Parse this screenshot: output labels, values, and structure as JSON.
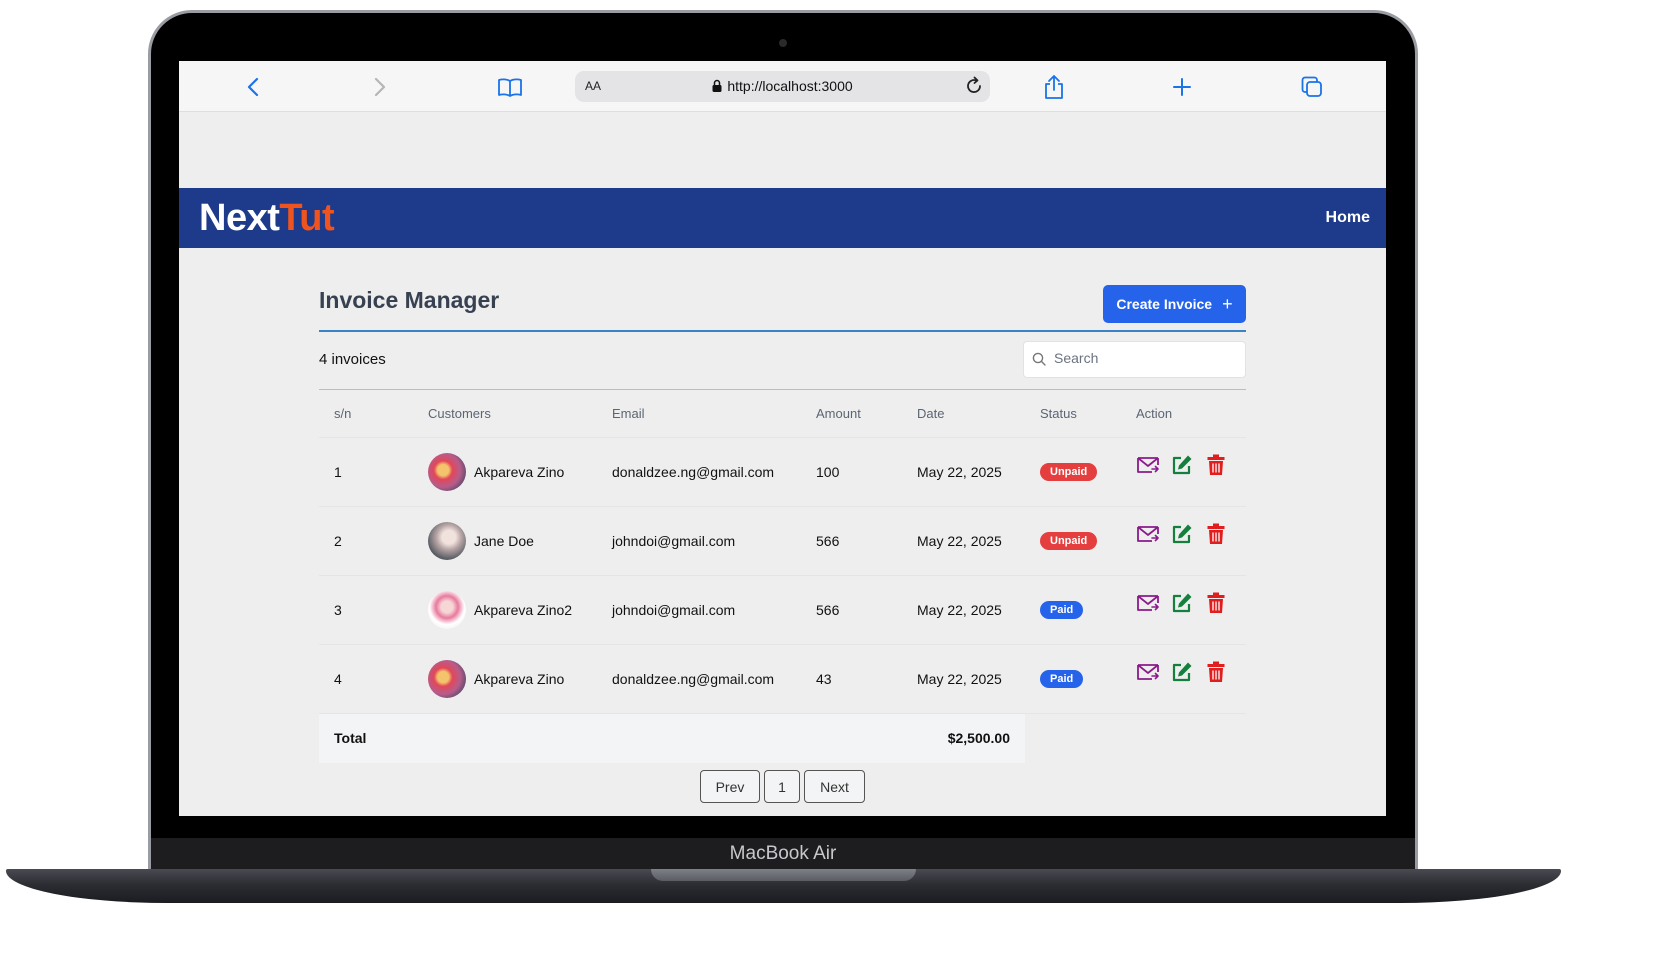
{
  "device": {
    "label": "MacBook Air"
  },
  "browser": {
    "url": "http://localhost:3000",
    "text_size_label": "AA"
  },
  "navbar": {
    "logo_part1": "Next",
    "logo_part2": "Tut",
    "home_label": "Home"
  },
  "page": {
    "title": "Invoice Manager",
    "create_button_label": "Create Invoice",
    "create_button_icon": "+",
    "count_text": "4 invoices",
    "search_placeholder": "Search"
  },
  "table": {
    "headers": [
      "s/n",
      "Customers",
      "Email",
      "Amount",
      "Date",
      "Status",
      "Action"
    ],
    "rows": [
      {
        "sn": "1",
        "customer": "Akpareva Zino",
        "email": "donaldzee.ng@gmail.com",
        "amount": "100",
        "date": "May 22, 2025",
        "status": "Unpaid"
      },
      {
        "sn": "2",
        "customer": "Jane Doe",
        "email": "johndoi@gmail.com",
        "amount": "566",
        "date": "May 22, 2025",
        "status": "Unpaid"
      },
      {
        "sn": "3",
        "customer": "Akpareva Zino2",
        "email": "johndoi@gmail.com",
        "amount": "566",
        "date": "May 22, 2025",
        "status": "Paid"
      },
      {
        "sn": "4",
        "customer": "Akpareva Zino",
        "email": "donaldzee.ng@gmail.com",
        "amount": "43",
        "date": "May 22, 2025",
        "status": "Paid"
      }
    ],
    "total_label": "Total",
    "total_value": "$2,500.00"
  },
  "pagination": {
    "prev_label": "Prev",
    "current_page": "1",
    "next_label": "Next"
  },
  "colors": {
    "navbar": "#1e3a8a",
    "logo_accent": "#f0541e",
    "primary_button": "#2563eb",
    "unpaid": "#e53e3e",
    "paid": "#2563eb",
    "send_icon": "#8b1a8b",
    "edit_icon": "#15803d",
    "delete_icon": "#e11d1d"
  },
  "icons": [
    "back-icon",
    "forward-icon",
    "bookmarks-icon",
    "lock-icon",
    "reload-icon",
    "share-icon",
    "new-tab-icon",
    "tabs-icon",
    "plus-icon",
    "search-icon",
    "send-icon",
    "edit-icon",
    "delete-icon"
  ]
}
